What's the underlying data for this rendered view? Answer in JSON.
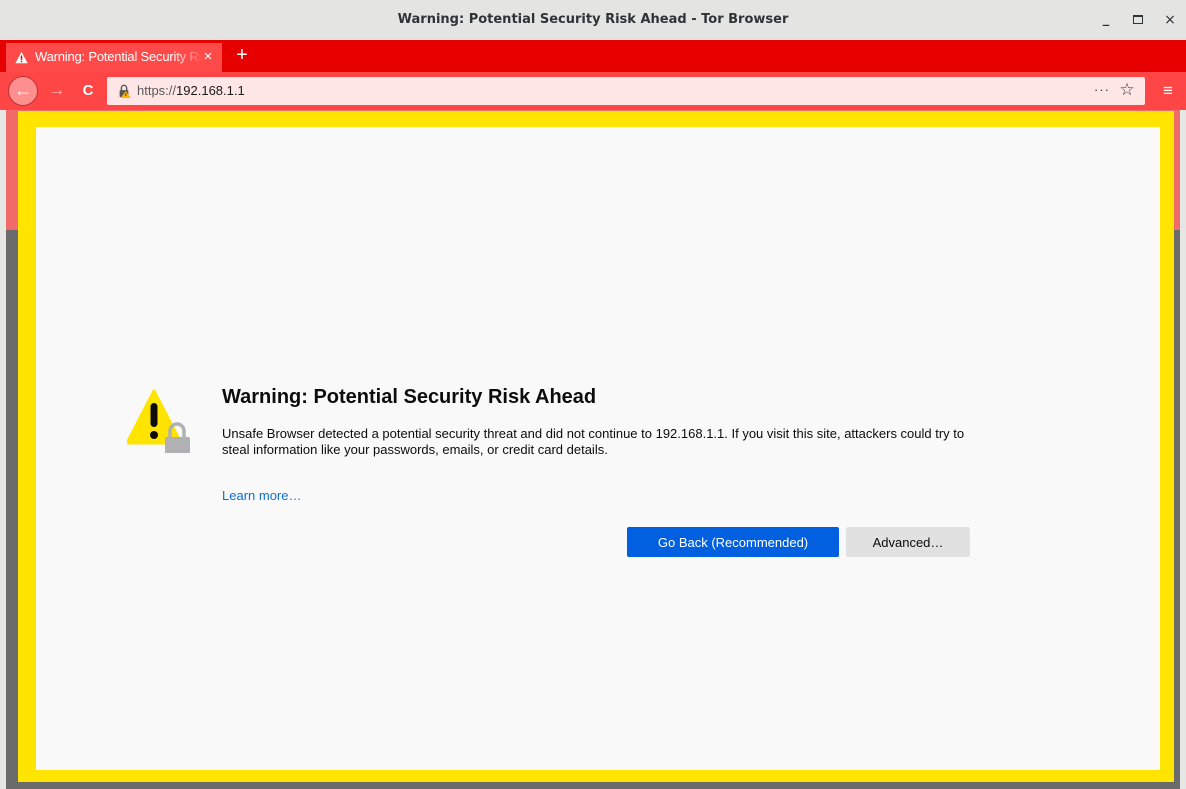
{
  "window": {
    "title": "Warning: Potential Security Risk Ahead - Tor Browser",
    "minimize_glyph": "_",
    "close_glyph": "×"
  },
  "tabs": [
    {
      "label": "Warning: Potential Security Risk Ahead",
      "icon": "warning-icon",
      "close_glyph": "×"
    }
  ],
  "new_tab_glyph": "+",
  "nav": {
    "back_glyph": "←",
    "forward_glyph": "→",
    "reload_glyph": "C",
    "menu_glyph": "≡",
    "url_scheme": "https://",
    "url_host": "192.168.1.1",
    "page_actions_glyph": "···",
    "bookmark_glyph": "☆"
  },
  "error_page": {
    "heading": "Warning: Potential Security Risk Ahead",
    "description": "Unsafe Browser detected a potential security threat and did not continue to 192.168.1.1. If you visit this site, attackers could try to steal information like your passwords, emails, or credit card details.",
    "learn_more": "Learn more…",
    "go_back_button": "Go Back (Recommended)",
    "advanced_button": "Advanced…"
  },
  "colors": {
    "tab_strip": "#e60000",
    "nav_bar": "#ff4646",
    "frame_border": "#ffe400",
    "primary_button": "#0060df",
    "link": "#0a70d6"
  }
}
